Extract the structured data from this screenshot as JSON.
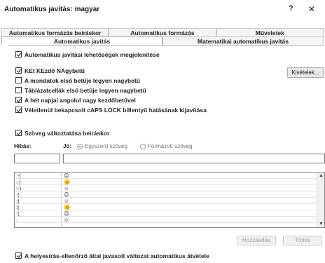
{
  "window": {
    "title": "Automatikus javítás: magyar",
    "help_label": "?",
    "close_label": "✕"
  },
  "tabs": {
    "row1": [
      "Automatikus formázás beíráskor",
      "Automatikus formázás",
      "Műveletek"
    ],
    "row2": [
      "Automatikus javítás",
      "Matematikai automatikus javítás"
    ]
  },
  "options": {
    "show_buttons": "Automatikus javítási lehetőségek megjelenítése",
    "two_initial_caps": "KEt KEzdő NAgybetű",
    "capitalize_sentence": "A mondatok első betűje legyen nagybetű",
    "capitalize_table_cells": "Táblázatcellák első betűje legyen nagybetű",
    "capitalize_days": "A hét napjai angolul nagy kezdőbetűvel",
    "caps_lock_fix": "Véletlenül bekapcsolt cAPS LOCK billentyű hatásának kijavítása",
    "replace_text": "Szöveg változtatása beíráskor",
    "spellcheck_auto": "A helyesírás-ellenőrző által javasolt változat automatikus átvétele"
  },
  "buttons": {
    "exceptions": "Kivételek...",
    "add": "Hozzáadás",
    "delete": "Törlés"
  },
  "replace": {
    "wrong_label": "Hibás:",
    "good_label": "Jó:",
    "plain_text": "Egyszerű szöveg",
    "formatted_text": "Formázott szöveg",
    "wrong_value": "",
    "good_value": ""
  },
  "replacement_list": [
    {
      "from": ":-(",
      "to": "☹"
    },
    {
      "from": ":-|",
      "to": "😐"
    },
    {
      "from": ":-)",
      "to": "☺"
    },
    {
      "from": ":(",
      "to": "☹"
    },
    {
      "from": ":)",
      "to": "☺"
    },
    {
      "from": ":|",
      "to": "😐"
    },
    {
      "from": ":(",
      "to": "☹"
    },
    {
      "from": ":",
      "to": "☺"
    }
  ]
}
